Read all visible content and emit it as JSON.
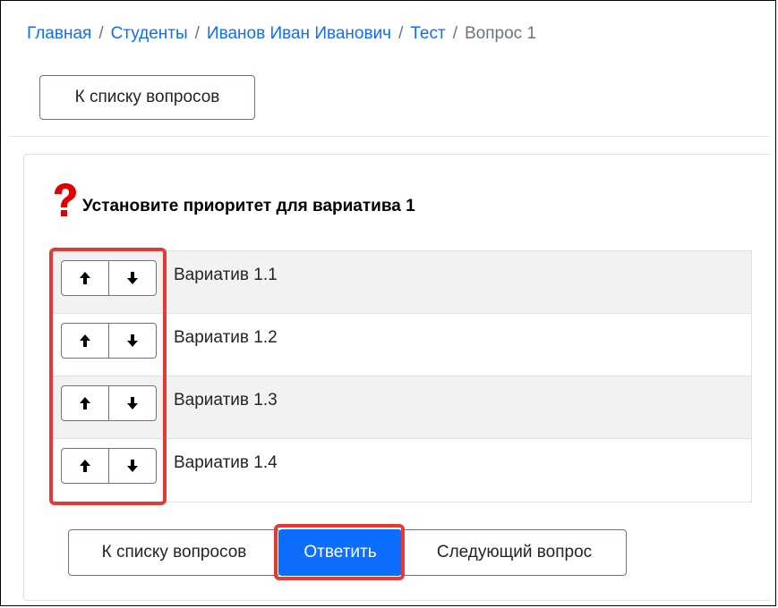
{
  "breadcrumb": {
    "items": [
      "Главная",
      "Студенты",
      "Иванов Иван Иванович",
      "Тест"
    ],
    "current": "Вопрос 1",
    "separator": "/"
  },
  "top_back_button": "К списку вопросов",
  "question": {
    "icon": "question-mark-icon",
    "text": "Установите приоритет для вариатива 1"
  },
  "variants": [
    {
      "label": "Вариатив 1.1"
    },
    {
      "label": "Вариатив 1.2"
    },
    {
      "label": "Вариатив 1.3"
    },
    {
      "label": "Вариатив 1.4"
    }
  ],
  "icons": {
    "up": "arrow-up-icon",
    "down": "arrow-down-icon"
  },
  "footer": {
    "back_label": "К списку вопросов",
    "answer_label": "Ответить",
    "next_label": "Следующий вопрос"
  },
  "colors": {
    "link": "#0d6efd",
    "primary": "#0d6efd",
    "highlight": "#e53935",
    "question_mark": "#e30000"
  }
}
